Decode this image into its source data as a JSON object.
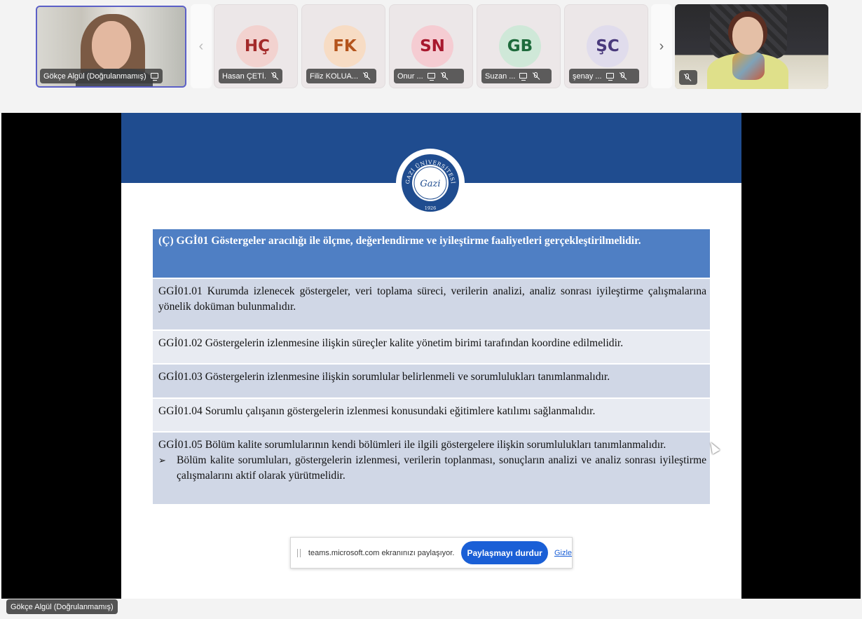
{
  "participants": [
    {
      "type": "video",
      "name": "Gökçe Algül (Doğrulanmamış)",
      "status_icon": "screen-share-icon"
    },
    {
      "type": "avatar",
      "initials": "HÇ",
      "name": "Hasan ÇETİ...",
      "bg": "#f2d2cf",
      "fg": "#a32a2a",
      "mic": "muted"
    },
    {
      "type": "avatar",
      "initials": "FK",
      "name": "Filiz KOLUA...",
      "bg": "#f7dcc4",
      "fg": "#b4541c",
      "mic": "muted"
    },
    {
      "type": "avatar",
      "initials": "SN",
      "name": "Onur ...",
      "bg": "#f5ccd2",
      "fg": "#a8182e",
      "mic": "muted"
    },
    {
      "type": "avatar",
      "initials": "GB",
      "name": "Suzan ...",
      "bg": "#cfe8d8",
      "fg": "#1e6b3c",
      "mic": "muted"
    },
    {
      "type": "avatar",
      "initials": "ŞC",
      "name": "şenay ...",
      "bg": "#e0dcec",
      "fg": "#4a3a7c",
      "mic": "muted"
    },
    {
      "type": "video",
      "name": "",
      "mic": "muted"
    }
  ],
  "nav": {
    "prev": "‹",
    "next": "›"
  },
  "slide": {
    "seal_text": "GAZİ ÜNİVERSİTESİ",
    "seal_year": "1926",
    "seal_script": "Gazi",
    "header": "(Ç) GGİ01 Göstergeler aracılığı ile ölçme, değerlendirme ve iyileştirme faaliyetleri gerçekleştirilmelidir.",
    "rows": [
      "GGİ01.01 Kurumda izlenecek göstergeler, veri toplama süreci, verilerin analizi, analiz sonrası iyileştirme çalışmalarına yönelik doküman bulunmalıdır.",
      "GGİ01.02 Göstergelerin izlenmesine ilişkin süreçler kalite yönetim birimi tarafından koordine edilmelidir.",
      "GGİ01.03 Göstergelerin izlenmesine ilişkin sorumlular belirlenmeli ve sorumlulukları tanımlanmalıdır.",
      "GGİ01.04 Sorumlu çalışanın göstergelerin izlenmesi konusundaki eğitimlere katılımı sağlanmalıdır.",
      "GGİ01.05 Bölüm kalite sorumlularının kendi bölümleri ile ilgili göstergelere ilişkin sorumlulukları tanımlanmalıdır."
    ],
    "bullet_mark": "➢",
    "bullet": "Bölüm kalite sorumluları, göstergelerin izlenmesi, verilerin toplanması, sonuçların analizi ve analiz sonrası iyileştirme çalışmalarını aktif olarak yürütmelidir."
  },
  "share_bar": {
    "text": "teams.microsoft.com ekranınızı paylaşıyor.",
    "stop_label": "Paylaşmayı durdur",
    "hide_label": "Gizle"
  },
  "presenter_label": "Gökçe Algül (Doğrulanmamış)",
  "colors": {
    "slide_band": "#1f4c8f",
    "header_row": "#4f7fc4",
    "row_dark": "#d0d7e6",
    "row_light": "#e8ebf2",
    "stop_button": "#1a5fd6"
  }
}
